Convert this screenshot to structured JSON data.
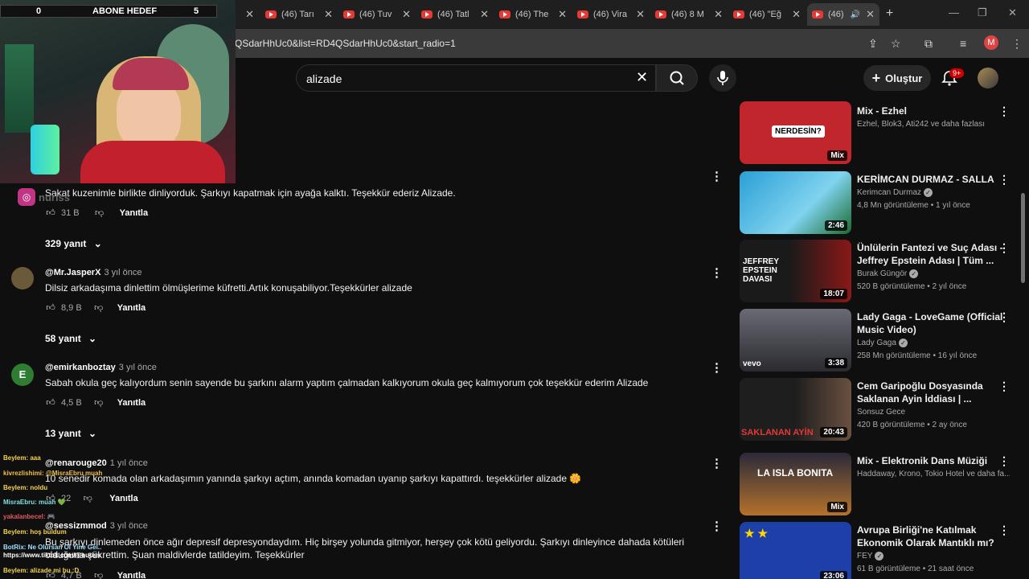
{
  "browser": {
    "tabs": [
      {
        "label": "(46) Tarı"
      },
      {
        "label": "(46) Tuv"
      },
      {
        "label": "(46) Tatl"
      },
      {
        "label": "(46) The"
      },
      {
        "label": "(46) Vira"
      },
      {
        "label": "(46) 8 M"
      },
      {
        "label": "(46) \"Eğ"
      },
      {
        "label": "(46)"
      }
    ],
    "new_tab": "+",
    "url": "QSdarHhUc0&list=RD4QSdarHhUc0&start_radio=1",
    "profile_initial": "M"
  },
  "youtube": {
    "search_value": "alizade",
    "create_label": "Oluştur",
    "notifications": "9+"
  },
  "overlay": {
    "goal_left": "0",
    "goal_label": "ABONE HEDEF",
    "goal_right": "5",
    "insta_name": "nuriss"
  },
  "comments": [
    {
      "text": "Sakat kuzenimle birlikte dinliyorduk. Şarkıyı kapatmak için ayağa kalktı. Teşekkür ederiz Alizade.",
      "likes": "31 B",
      "reply": "Yanıtla",
      "replies": "329 yanıt"
    },
    {
      "author": "@Mr.JasperX",
      "time": "3 yıl önce",
      "text": "Dilsiz arkadaşıma dinlettim ölmüşlerime küfretti.Artık konuşabiliyor.Teşekkürler alizade",
      "likes": "8,9 B",
      "reply": "Yanıtla",
      "replies": "58 yanıt"
    },
    {
      "author": "@emirkanboztay",
      "time": "3 yıl önce",
      "initial": "E",
      "text": "Sabah okula geç kalıyordum senin sayende bu şarkını alarm yaptım çalmadan kalkıyorum okula geç kalmıyorum çok teşekkür ederim Alizade",
      "likes": "4,5 B",
      "reply": "Yanıtla",
      "replies": "13 yanıt"
    },
    {
      "author": "@renarouge20",
      "time": "1 yıl önce",
      "text": "10 senedir komada olan arkadaşımın yanında şarkıyı açtım,  anında komadan uyanıp şarkıyı kapattırdı. teşekkürler alizade 🌼",
      "likes": "22",
      "reply": "Yanıtla"
    },
    {
      "author": "@sessizmmod",
      "time": "3 yıl önce",
      "text": "Bu şarkıyı dinlemeden önce ağır depresif depresyondaydım. Hiç birşey yolunda gitmiyor, herşey çok kötü geliyordu. Şarkıyı dinleyince dahada kötüleri olduğuna şükrettim. Şuan maldivlerde tatildeyim. Teşekkürler",
      "likes": "4,7 B",
      "reply": "Yanıtla"
    }
  ],
  "chat": [
    "Beylem: aaa",
    "kivrezlishimi: @MisraEbru muah",
    "Beylem: noldu",
    "MisraEbru: muah 💚",
    "yakalanbecel: 🎮",
    "Beylem: hoş buldum",
    "BotRix: Ne Olursan Ol Yine Gel..",
    "https://www.tiktok.com/@nuriss",
    "Beylem: alizade mi bu :D"
  ],
  "sidebar": [
    {
      "title": "Mix - Ezhel",
      "channel": "Ezhel, Blok3, Ati242 ve daha fazlası",
      "badge": "Mix",
      "thumb_text": "NERDESİN?",
      "thumb_color": "#c0262c"
    },
    {
      "title": "KERİMCAN DURMAZ - SALLA",
      "channel": "Kerimcan Durmaz",
      "meta": "4,8 Mn görüntüleme • 1 yıl önce",
      "badge": "2:46",
      "thumb_color": "#2a9fd6"
    },
    {
      "title": "Ünlülerin Fantezi ve Suç Adası - Jeffrey Epstein Adası | Tüm ...",
      "channel": "Burak Güngör",
      "meta": "520 B görüntüleme • 2 yıl önce",
      "badge": "18:07",
      "thumb_text": "JEFFREY EPSTEIN DAVASI",
      "thumb_color": "#8a1818"
    },
    {
      "title": "Lady Gaga - LoveGame (Official Music Video)",
      "channel": "Lady Gaga",
      "meta": "258 Mn görüntüleme • 16 yıl önce",
      "badge": "3:38",
      "thumb_text": "vevo",
      "thumb_color": "#4a4a52"
    },
    {
      "title": "Cem Garipoğlu Dosyasında Saklanan Ayin İddiası | ...",
      "channel": "Sonsuz Gece",
      "meta": "420 B görüntüleme • 2 ay önce",
      "badge": "20:43",
      "thumb_text": "SAKLANAN AYİN",
      "thumb_color": "#3a3a3a"
    },
    {
      "title": "Mix - Elektronik Dans Müziği",
      "channel": "Haddaway, Krono, Tokio Hotel ve daha fa...",
      "badge": "Mix",
      "thumb_text": "LA ISLA BONITA",
      "thumb_color": "#b5722a"
    },
    {
      "title": "Avrupa Birliği'ne Katılmak Ekonomik Olarak Mantıklı mı?",
      "channel": "FEY",
      "meta": "61 B görüntüleme • 21 saat önce",
      "badge": "23:06",
      "thumb_color": "#1f3fa8"
    }
  ],
  "colors": {
    "accent": "#cc0000",
    "bg": "#0f0f0f"
  }
}
